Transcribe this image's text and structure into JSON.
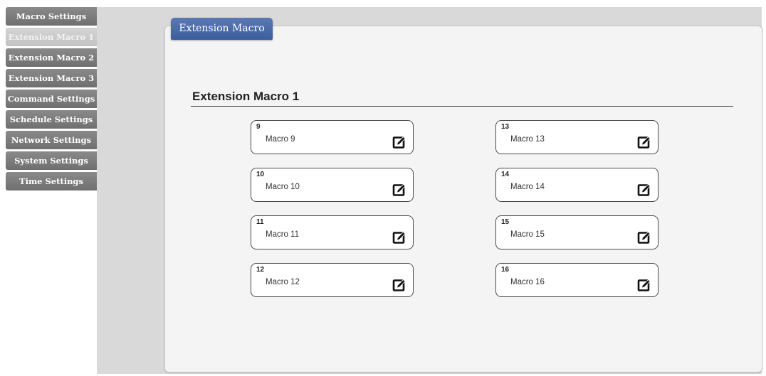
{
  "sidebar": {
    "items": [
      {
        "label": "Macro Settings",
        "active": false
      },
      {
        "label": "Extension Macro 1",
        "active": true
      },
      {
        "label": "Extension Macro 2",
        "active": false
      },
      {
        "label": "Extension Macro 3",
        "active": false
      },
      {
        "label": "Command Settings",
        "active": false
      },
      {
        "label": "Schedule Settings",
        "active": false
      },
      {
        "label": "Network Settings",
        "active": false
      },
      {
        "label": "System Settings",
        "active": false
      },
      {
        "label": "Time Settings",
        "active": false
      }
    ]
  },
  "tab": {
    "label": "Extension Macro"
  },
  "section": {
    "title": "Extension Macro 1"
  },
  "macros": [
    {
      "number": "9",
      "name": "Macro 9"
    },
    {
      "number": "10",
      "name": "Macro 10"
    },
    {
      "number": "11",
      "name": "Macro 11"
    },
    {
      "number": "12",
      "name": "Macro 12"
    },
    {
      "number": "13",
      "name": "Macro 13"
    },
    {
      "number": "14",
      "name": "Macro 14"
    },
    {
      "number": "15",
      "name": "Macro 15"
    },
    {
      "number": "16",
      "name": "Macro 16"
    }
  ],
  "icons": {
    "edit": "edit-icon"
  },
  "colors": {
    "tab_accent": "#4a6aa9",
    "sidebar_button": "#7d7d7d",
    "sidebar_active": "#cccccc"
  }
}
